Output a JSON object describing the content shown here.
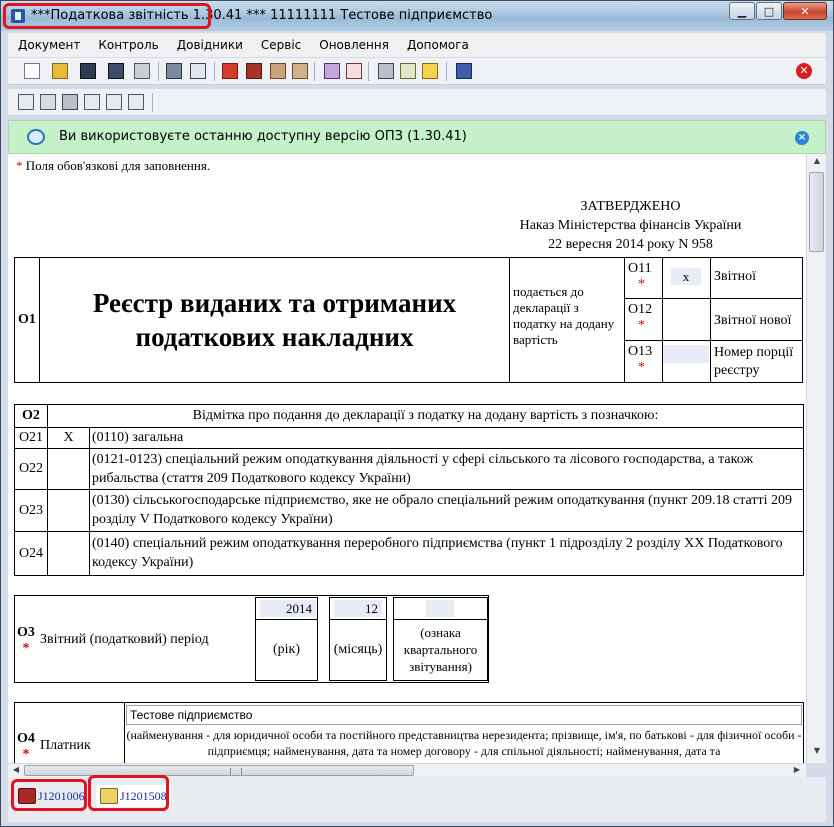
{
  "window": {
    "title": "***Податкова звітність 1.30.41 *** 11111111 Тестове підприємство",
    "minimize": "▁",
    "maximize": "□",
    "close": "✕"
  },
  "menu": [
    "Документ",
    "Контроль",
    "Довідники",
    "Сервіс",
    "Оновлення",
    "Допомога"
  ],
  "banner": {
    "text": "Ви використовуєте останню доступну версію ОПЗ (1.30.41)",
    "close": "×"
  },
  "doc": {
    "required_star": "*",
    "required_note": "Поля обов'язкові для заповнення.",
    "approved_title": "ЗАТВЕРДЖЕНО",
    "approved_line1": "Наказ Міністерства фінансів України",
    "approved_line2": "22 вересня 2014 року N 958",
    "o1_label": "О1",
    "title_line1": "Реєстр виданих та отриманих",
    "title_line2": "податкових накладних",
    "submitted_text": "подається до декларації з податку на додану вартість",
    "o11": {
      "label": "О11",
      "value": "x",
      "desc": "Звітної"
    },
    "o12": {
      "label": "О12",
      "value": "",
      "desc": "Звітної нової"
    },
    "o13": {
      "label": "О13",
      "value": "",
      "desc": "Номер порції реєстру"
    },
    "o2_label": "О2",
    "o2_header": "Відмітка про подання до декларації з податку на додану вартість з позначкою:",
    "o2_rows": [
      {
        "code": "О21",
        "mark": "X",
        "text": "(0110) загальна"
      },
      {
        "code": "О22",
        "mark": "",
        "text": "(0121-0123) спеціальний режим оподаткування діяльності у сфері сільського та лісового господарства, а також рибальства (стаття 209 Податкового кодексу України)"
      },
      {
        "code": "О23",
        "mark": "",
        "text": "(0130) сільськогосподарське підприємство, яке не обрало спеціальний режим оподаткування (пункт 209.18 статті 209 розділу V Податкового кодексу України)"
      },
      {
        "code": "О24",
        "mark": "",
        "text": "(0140) спеціальний режим оподаткування переробного підприємства (пункт 1 підрозділу 2 розділу XX Податкового кодексу України)"
      }
    ],
    "o3_label": "О3",
    "o3_text": "Звітний (податковий) період",
    "year_value": "2014",
    "year_label": "(рік)",
    "month_value": "12",
    "month_label": "(місяць)",
    "quarter_value": "",
    "quarter_label": "(ознака квартального звітування)",
    "o4_label": "О4",
    "o4_text": "Платник",
    "payer_name": "Тестове підприємство",
    "payer_note": "(найменування - для юридичної особи та постійного представництва нерезидента; прізвище, ім'я, по батькові - для фізичної особи - підприємця; найменування, дата та номер договору - для спільної діяльності; найменування, дата та"
  },
  "tabs": [
    {
      "label": "J1201006"
    },
    {
      "label": "J1201508"
    }
  ],
  "colors": {
    "highlight": "#e0141e",
    "banner": "#c5f0c8",
    "input": "#e8ecf6"
  }
}
